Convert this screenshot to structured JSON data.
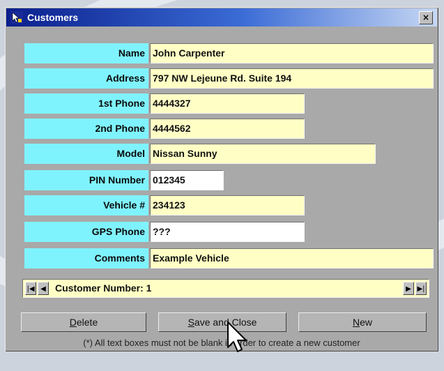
{
  "window": {
    "title": "Customers",
    "close_label": "×"
  },
  "fields": [
    {
      "label": "Name",
      "value": "John Carpenter"
    },
    {
      "label": "Address",
      "value": "797 NW Lejeune Rd. Suite 194"
    },
    {
      "label": "1st Phone",
      "value": "4444327"
    },
    {
      "label": "2nd Phone",
      "value": "4444562"
    },
    {
      "label": "Model",
      "value": "Nissan Sunny"
    },
    {
      "label": "PIN Number",
      "value": "012345"
    },
    {
      "label": "Vehicle #",
      "value": "234123"
    },
    {
      "label": "GPS Phone",
      "value": "???"
    },
    {
      "label": "Comments",
      "value": "Example Vehicle"
    }
  ],
  "navigator": {
    "first": "|◀",
    "prev": "◀",
    "next": "▶",
    "last": "▶|",
    "text": "Customer Number: 1"
  },
  "buttons": {
    "delete_first": "D",
    "delete_rest": "elete",
    "save_first": "S",
    "save_rest": "ave and Close",
    "new_first": "N",
    "new_rest": "ew"
  },
  "footnote": "(*) All text boxes must not be blank in order to create a new customer",
  "colors": {
    "label_bg": "#7ff3fd",
    "field_bg": "#ffffc5",
    "title_start": "#0a1f8c"
  }
}
